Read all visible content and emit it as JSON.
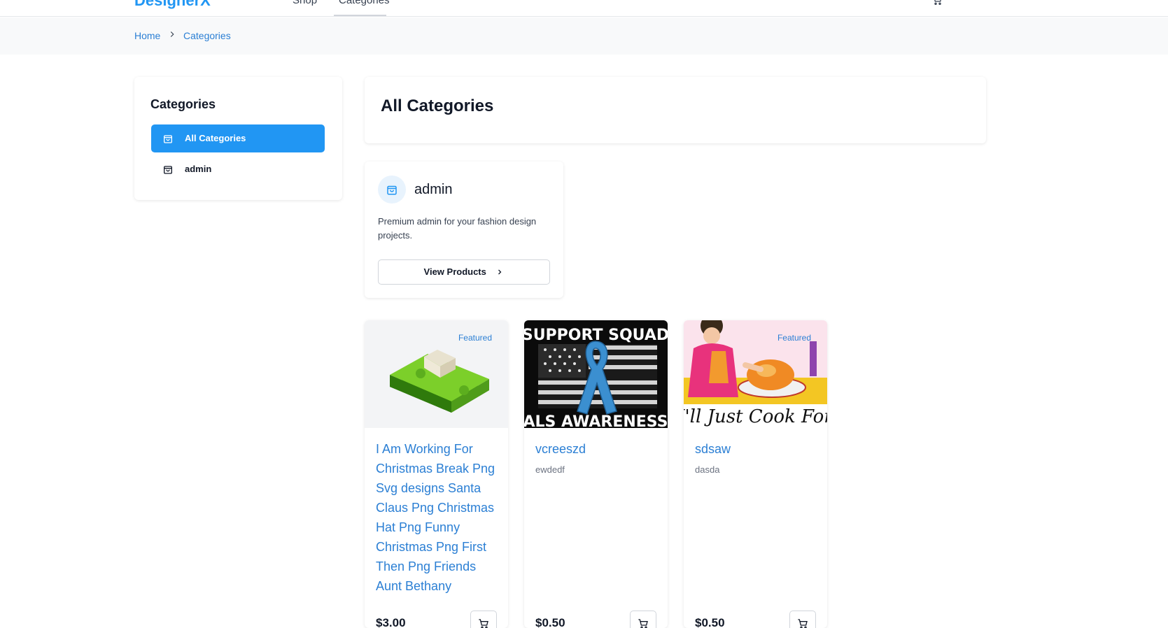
{
  "nav": {
    "logo": "DesignerX",
    "links": [
      "Shop",
      "Categories"
    ],
    "cart_icon": "cart-icon"
  },
  "breadcrumb": {
    "home": "Home",
    "current": "Categories",
    "separator_icon": "chevron-right-icon"
  },
  "sidebar": {
    "title": "Categories",
    "items": [
      {
        "label": "All Categories",
        "icon": "shopping-bag-icon",
        "active": true
      },
      {
        "label": "admin",
        "icon": "shopping-bag-icon",
        "active": false
      }
    ]
  },
  "main": {
    "title": "All Categories",
    "category_card": {
      "name": "admin",
      "icon": "shopping-bag-icon",
      "description": "Premium admin for your fashion design projects.",
      "button_label": "View Products"
    },
    "products": [
      {
        "title": "I Am Working For Christmas Break Png Svg designs Santa Claus Png Christmas Hat Png Funny Christmas Png First Then Png Friends Aunt Bethany",
        "subtitle": "",
        "price": "$3.00",
        "badge": "Featured",
        "image": "money-stack-image"
      },
      {
        "title": "vcreeszd",
        "subtitle": "ewdedf",
        "price": "$0.50",
        "badge": "",
        "image": "als-awareness-shirt-image",
        "image_text_top": "SUPPORT SQUAD",
        "image_text_bottom": "ALS AWARENESS"
      },
      {
        "title": "sdsaw",
        "subtitle": "dasda",
        "price": "$0.50",
        "badge": "Featured",
        "image": "cooking-woman-image",
        "image_text_bottom": "I'll Just Cook For"
      }
    ]
  },
  "colors": {
    "accent": "#2196f3",
    "link": "#2b7fd4",
    "breadcrumb_bg": "#f8f9fa"
  }
}
